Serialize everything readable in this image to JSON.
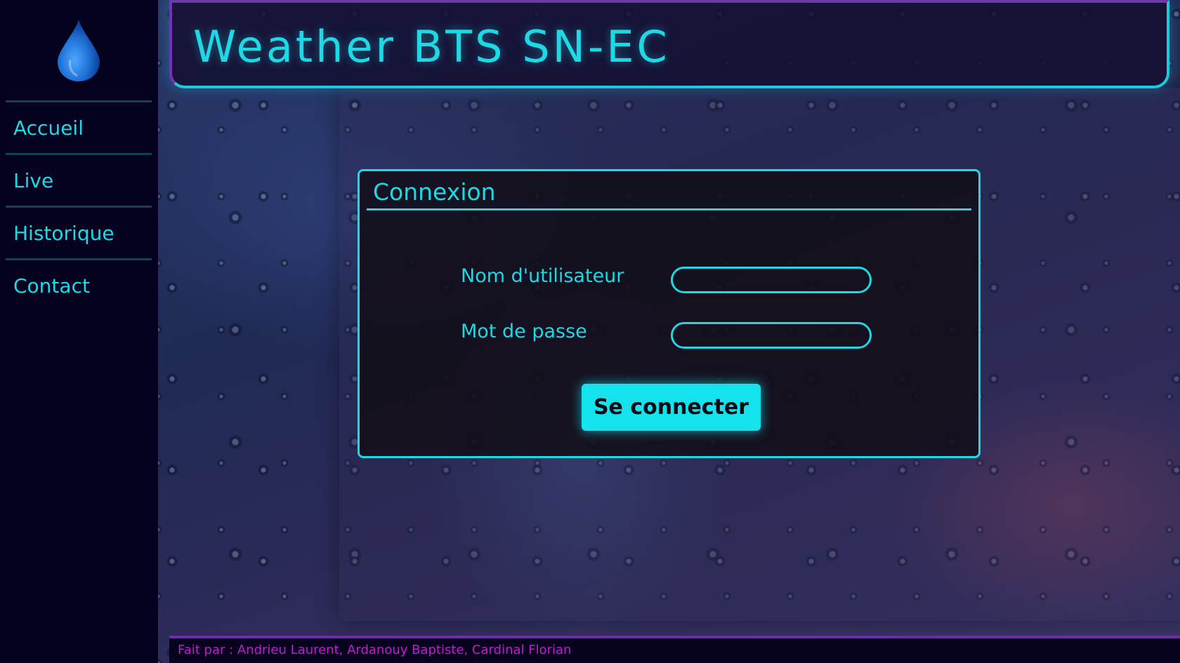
{
  "header": {
    "title": "Weather BTS SN-EC"
  },
  "sidebar": {
    "logo_icon": "water-drop-icon",
    "items": [
      {
        "label": "Accueil"
      },
      {
        "label": "Live"
      },
      {
        "label": "Historique"
      },
      {
        "label": "Contact"
      }
    ]
  },
  "login": {
    "title": "Connexion",
    "username_label": "Nom d'utilisateur",
    "username_value": "",
    "password_label": "Mot de passe",
    "password_value": "",
    "submit_label": "Se connecter"
  },
  "footer": {
    "text": "Fait par : Andrieu Laurent, Ardanouy Baptiste, Cardinal Florian"
  },
  "colors": {
    "accent": "#1ed8e6",
    "button": "#14e3ee",
    "sidebar_bg": "#05021f",
    "footer_text": "#c21ccf",
    "footer_border": "#6d2bb0"
  }
}
